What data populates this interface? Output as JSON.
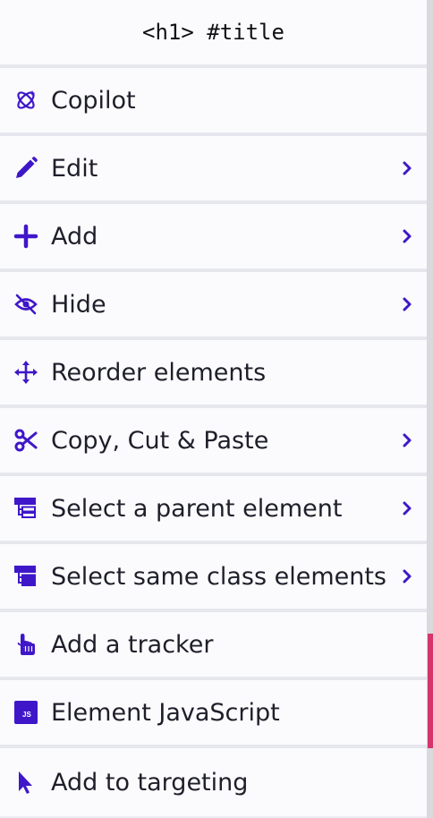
{
  "header": {
    "title": "<h1> #title"
  },
  "colors": {
    "accent": "#3f17c9",
    "text": "#1f1f2b",
    "item_bg": "#fbfbfd",
    "divider": "#e6e6ee"
  },
  "items": [
    {
      "label": "Copilot",
      "icon": "copilot-icon",
      "has_submenu": false
    },
    {
      "label": "Edit",
      "icon": "pencil-icon",
      "has_submenu": true
    },
    {
      "label": "Add",
      "icon": "plus-icon",
      "has_submenu": true
    },
    {
      "label": "Hide",
      "icon": "eye-slash-icon",
      "has_submenu": true
    },
    {
      "label": "Reorder elements",
      "icon": "move-arrows-icon",
      "has_submenu": false
    },
    {
      "label": "Copy, Cut & Paste",
      "icon": "scissors-icon",
      "has_submenu": true
    },
    {
      "label": "Select a parent element",
      "icon": "parent-hierarchy-icon",
      "has_submenu": true
    },
    {
      "label": "Select same class elements",
      "icon": "class-hierarchy-icon",
      "has_submenu": true
    },
    {
      "label": "Add a tracker",
      "icon": "pointer-hand-icon",
      "has_submenu": false
    },
    {
      "label": "Element JavaScript",
      "icon": "js-icon",
      "icon_text": "JS",
      "has_submenu": false
    },
    {
      "label": "Add to targeting",
      "icon": "cursor-arrow-icon",
      "has_submenu": false
    }
  ]
}
